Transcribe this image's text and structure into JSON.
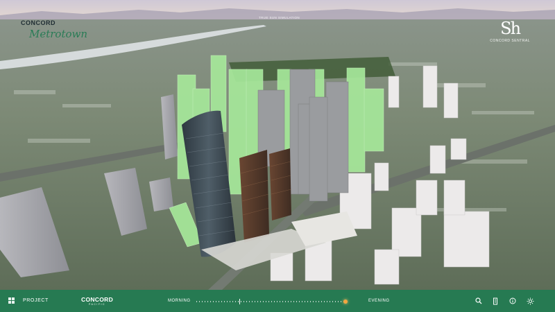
{
  "brand": {
    "top_left_name": "CONCORD",
    "top_left_project": "Metrotown",
    "top_right_mark": "Sh",
    "top_right_sub": "CONCORD SENTRAL"
  },
  "scene": {
    "label": "TRUE SUN SIMULATION"
  },
  "bottom_bar": {
    "project_label": "PROJECT",
    "logo_main": "CONCORD",
    "logo_sub": "PACIFIC",
    "morning_label": "MORNING",
    "evening_label": "EVENING",
    "time_of_day": 0.97
  },
  "icons": [
    "menu-grid-icon",
    "search-icon",
    "building-icon",
    "info-icon",
    "sun-icon"
  ],
  "colors": {
    "bar": "#267a52",
    "highlight_towers": "#a6e89a",
    "thumb": "#f2a640"
  }
}
